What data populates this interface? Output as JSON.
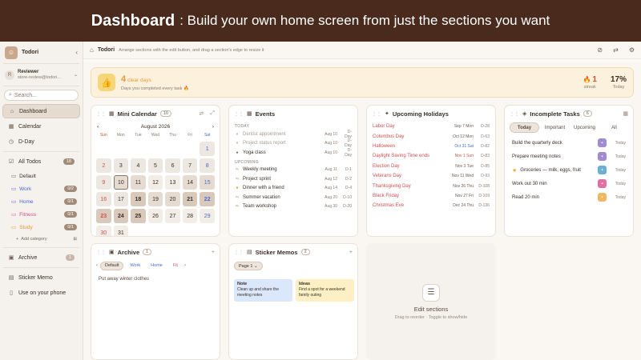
{
  "banner": {
    "title": "Dashboard",
    "subtitle": ": Build your own home screen from just the sections you want"
  },
  "sidebar": {
    "workspace": "Todori",
    "user": {
      "name": "Reviewer",
      "email": "store-review@todori...",
      "initial": "R"
    },
    "search_placeholder": "Search...",
    "nav": [
      {
        "label": "Dashboard",
        "icon": "home-icon"
      },
      {
        "label": "Calendar",
        "icon": "calendar-icon"
      },
      {
        "label": "D-Day",
        "icon": "clock-icon"
      },
      {
        "label": "All Todos",
        "icon": "check-icon",
        "count": "18"
      }
    ],
    "categories": [
      {
        "label": "Default",
        "color": "#5a4a3e",
        "count": ""
      },
      {
        "label": "Work",
        "color": "#4a6ad0",
        "count": "0/2"
      },
      {
        "label": "Home",
        "color": "#4a6ad0",
        "count": "0/1"
      },
      {
        "label": "Fitness",
        "color": "#d05090",
        "count": "0/1"
      },
      {
        "label": "Study",
        "color": "#e59a3a",
        "count": "0/1"
      }
    ],
    "add_category": "Add category",
    "archive": {
      "label": "Archive",
      "count": "1"
    },
    "sticker_memo": "Sticker Memo",
    "use_phone": "Use on your phone"
  },
  "topbar": {
    "title": "Todori",
    "hint": "Arrange sections with the edit button, and drag a section's edge to resize it"
  },
  "streak": {
    "value": "4",
    "unit": "clear days",
    "desc": "Days you completed every task 🔥",
    "streak_value": "1",
    "streak_label": "streak",
    "today_value": "17%",
    "today_label": "Today"
  },
  "calendar": {
    "title": "Mini Calendar",
    "count": "10",
    "month": "August 2026",
    "dow": [
      "Sun",
      "Mon",
      "Tue",
      "Wed",
      "Thu",
      "Fri",
      "Sat"
    ],
    "today": 10,
    "levels": {
      "10": 2,
      "11": 2,
      "12": 1,
      "13": 1,
      "14": 2,
      "15": 2,
      "18": 3,
      "19": 2,
      "20": 2,
      "21": 3,
      "22": 3,
      "23": 3,
      "24": 3,
      "25": 3,
      "26": 1,
      "27": 1,
      "28": 1,
      "29": 1,
      "30": 1,
      "31": 1
    }
  },
  "events": {
    "title": "Events",
    "today_label": "TODAY",
    "today": [
      {
        "name": "Dentist appointment",
        "date": "Aug 10",
        "rel": "D-Day"
      },
      {
        "name": "Project status report",
        "date": "Aug 10",
        "rel": "D-Day"
      },
      {
        "name": "Yoga class",
        "date": "Aug 10",
        "rel": "D-Day"
      }
    ],
    "upcoming_label": "UPCOMING",
    "upcoming": [
      {
        "name": "Weekly meeting",
        "date": "Aug 11",
        "rel": "D-1"
      },
      {
        "name": "Project sprint",
        "date": "Aug 12",
        "rel": "D-2"
      },
      {
        "name": "Dinner with a friend",
        "date": "Aug 14",
        "rel": "D-4"
      },
      {
        "name": "Summer vacation",
        "date": "Aug 20",
        "rel": "D-10"
      },
      {
        "name": "Team workshop",
        "date": "Aug 30",
        "rel": "D-20"
      }
    ]
  },
  "holidays": {
    "title": "Upcoming Holidays",
    "items": [
      {
        "name": "Labor Day",
        "date": "Sep 7 Mon",
        "rel": "D-28"
      },
      {
        "name": "Columbus Day",
        "date": "Oct 12 Mon",
        "rel": "D-63"
      },
      {
        "name": "Halloween",
        "date": "Oct 31 Sat",
        "rel": "D-82"
      },
      {
        "name": "Daylight Saving Time ends",
        "date": "Nov 1 Sun",
        "rel": "D-83"
      },
      {
        "name": "Election Day",
        "date": "Nov 3 Tue",
        "rel": "D-85"
      },
      {
        "name": "Veterans Day",
        "date": "Nov 11 Wed",
        "rel": "D-93"
      },
      {
        "name": "Thanksgiving Day",
        "date": "Nov 26 Thu",
        "rel": "D-108"
      },
      {
        "name": "Black Friday",
        "date": "Nov 27 Fri",
        "rel": "D-109"
      },
      {
        "name": "Christmas Eve",
        "date": "Dec 24 Thu",
        "rel": "D-136"
      }
    ]
  },
  "tasks": {
    "title": "Incomplete Tasks",
    "count": "6",
    "tabs": [
      "Today",
      "Important",
      "Upcoming",
      "All"
    ],
    "items": [
      {
        "name": "Build the quarterly deck",
        "date": "Today",
        "color": "#a08ad0",
        "star": false
      },
      {
        "name": "Prepare meeting notes",
        "date": "Today",
        "color": "#a08ad0",
        "star": false
      },
      {
        "name": "Groceries — milk, eggs, fruit",
        "date": "Today",
        "color": "#6ab0d0",
        "star": true
      },
      {
        "name": "Work out 30 min",
        "date": "Today",
        "color": "#e070a0",
        "star": false
      },
      {
        "name": "Read 20 min",
        "date": "Today",
        "color": "#f0b860",
        "star": false
      }
    ]
  },
  "archive": {
    "title": "Archive",
    "count": "1",
    "chips": [
      "Default",
      "Work",
      "Home",
      "Fit"
    ],
    "item": "Put away winter clothes"
  },
  "memos": {
    "title": "Sticker Memos",
    "count": "2",
    "page": "Page 1",
    "items": [
      {
        "title": "Note",
        "body": "Clean up and share the meeting notes",
        "color": "#dbe8fb"
      },
      {
        "title": "Ideas",
        "body": "Find a spot for a weekend family outing",
        "color": "#fcf0c4"
      }
    ]
  },
  "edit": {
    "title": "Edit sections",
    "sub": "Drag to reorder · Toggle to show/hide"
  }
}
